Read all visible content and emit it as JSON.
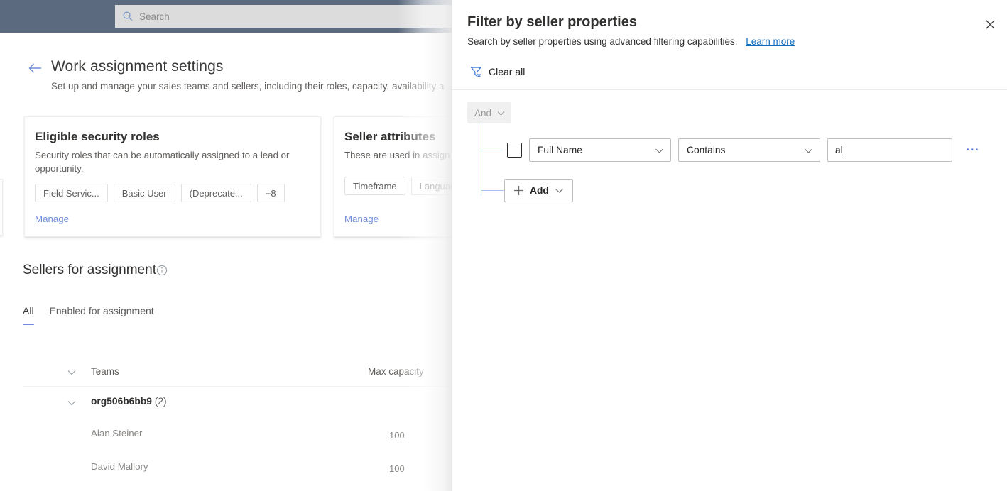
{
  "background": {
    "search": {
      "placeholder": "Search",
      "icon": "search-icon"
    },
    "back_icon": "back-arrow-icon",
    "title": "Work assignment settings",
    "subtitle": "Set up and manage your sales teams and sellers, including their roles, capacity, availability a",
    "cards": [
      {
        "title": "Eligible security roles",
        "description": "Security roles that can be automatically assigned to a lead or opportunity.",
        "chips": [
          "Field Servic...",
          "Basic User",
          "(Deprecate...",
          "+8"
        ],
        "link": "Manage"
      },
      {
        "title": "Seller attributes",
        "description": "These are used in assign",
        "chips": [
          "Timeframe",
          "Languag"
        ],
        "link": "Manage"
      }
    ],
    "sellers_section": {
      "title": "Sellers for assignment",
      "info_icon": "info-icon",
      "tabs": [
        {
          "label": "All",
          "active": true
        },
        {
          "label": "Enabled for assignment",
          "active": false
        }
      ],
      "columns": [
        "Teams",
        "Max capacity"
      ],
      "group": {
        "name": "org506b6bb9",
        "count": "(2)",
        "expand_icon": "chevron-down-icon"
      },
      "rows": [
        {
          "name": "Alan Steiner",
          "capacity": "100"
        },
        {
          "name": "David Mallory",
          "capacity": "100"
        }
      ]
    }
  },
  "panel": {
    "title": "Filter by seller properties",
    "subtitle": "Search by seller properties using advanced filtering capabilities.",
    "learn_more": "Learn more",
    "close_icon": "close-icon",
    "clear_all": {
      "label": "Clear all",
      "icon": "filter-clear-icon"
    },
    "group": {
      "operator": "And",
      "chevron_icon": "chevron-down-icon"
    },
    "filter_row": {
      "checkbox_checked": false,
      "field": "Full Name",
      "operator": "Contains",
      "value": "al",
      "overflow_icon": "more-options-icon"
    },
    "add_button": {
      "label": "Add",
      "plus_icon": "plus-icon",
      "chevron_icon": "chevron-down-icon"
    }
  },
  "colors": {
    "topbar": "#5b6a7f",
    "accent_link": "#0f6cbd",
    "tab_underline": "#6f8ddb",
    "tree_line": "#a9c5ee",
    "panel_bg": "#ffffff"
  }
}
